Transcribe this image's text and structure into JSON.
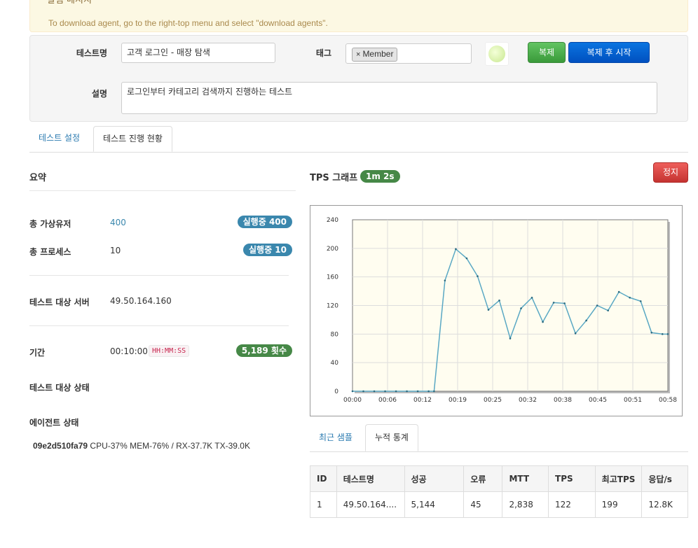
{
  "alert": {
    "title": "알림 메시지",
    "message": "To download agent, go to the right-top menu and select \"download agents\"."
  },
  "form": {
    "test_name_label": "테스트명",
    "test_name_value": "고객 로그인 - 매장 탐색",
    "tag_label": "태그",
    "tag_remove": "×",
    "tag_value": "Member",
    "description_label": "설명",
    "description_value": "로그인부터 카테고리 검색까지 진행하는 테스트",
    "clone_button": "복제",
    "clone_start_button": "복제 후 시작"
  },
  "tabs": [
    "테스트 설정",
    "테스트 진행 현황"
  ],
  "summary": {
    "heading": "요약",
    "vusers_label": "총 가상유저",
    "vusers_value": "400",
    "vusers_badge": "실행중 400",
    "process_label": "총 프로세스",
    "process_value": "10",
    "process_badge": "실행중 10",
    "target_server_label": "테스트 대상 서버",
    "target_server_value": "49.50.164.160",
    "duration_label": "기간",
    "duration_value": "00:10:00",
    "duration_format": "HH:MM:SS",
    "duration_badge": "5,189  횟수",
    "target_status_label": "테스트 대상 상태",
    "agent_status_label": "에이전트 상태",
    "agent_id": "09e2d510fa79",
    "agent_metrics": "CPU-37% MEM-76% / RX-37.7K TX-39.0K"
  },
  "tps": {
    "heading": "TPS 그래프",
    "elapsed_badge": "1m 2s",
    "stop_button": "정지"
  },
  "chart_data": {
    "type": "line",
    "title": "",
    "xlabel": "",
    "ylabel": "",
    "ylim": [
      0,
      240
    ],
    "y_ticks": [
      0,
      40,
      80,
      120,
      160,
      200,
      240
    ],
    "x_ticks": [
      "00:00",
      "00:06",
      "00:12",
      "00:19",
      "00:25",
      "00:32",
      "00:38",
      "00:45",
      "00:51",
      "00:58"
    ],
    "xlim": [
      0,
      58
    ],
    "grid": true,
    "color": "#5aa8c4",
    "series": [
      {
        "x": [
          0,
          2,
          4,
          6,
          8,
          10,
          12,
          14,
          15,
          17,
          19,
          21,
          23,
          25,
          27,
          29,
          31,
          33,
          35,
          37,
          39,
          41,
          43,
          45,
          47,
          49,
          51,
          53,
          55,
          57,
          58
        ],
        "values": [
          0,
          0,
          0,
          0,
          0,
          0,
          0,
          0,
          0,
          155,
          199,
          186,
          161,
          114,
          127,
          74,
          116,
          131,
          97,
          124,
          123,
          81,
          99,
          120,
          113,
          139,
          131,
          126,
          82,
          80,
          80
        ]
      }
    ]
  },
  "bottom_tabs": [
    "최근 샘플",
    "누적 통계"
  ],
  "stats_table": {
    "headers": [
      "ID",
      "테스트명",
      "성공",
      "오류",
      "MTT",
      "TPS",
      "최고TPS",
      "응답/s"
    ],
    "rows": [
      [
        "1",
        "49.50.164....",
        "5,144",
        "45",
        "2,838",
        "122",
        "199",
        "12.8K"
      ]
    ]
  }
}
